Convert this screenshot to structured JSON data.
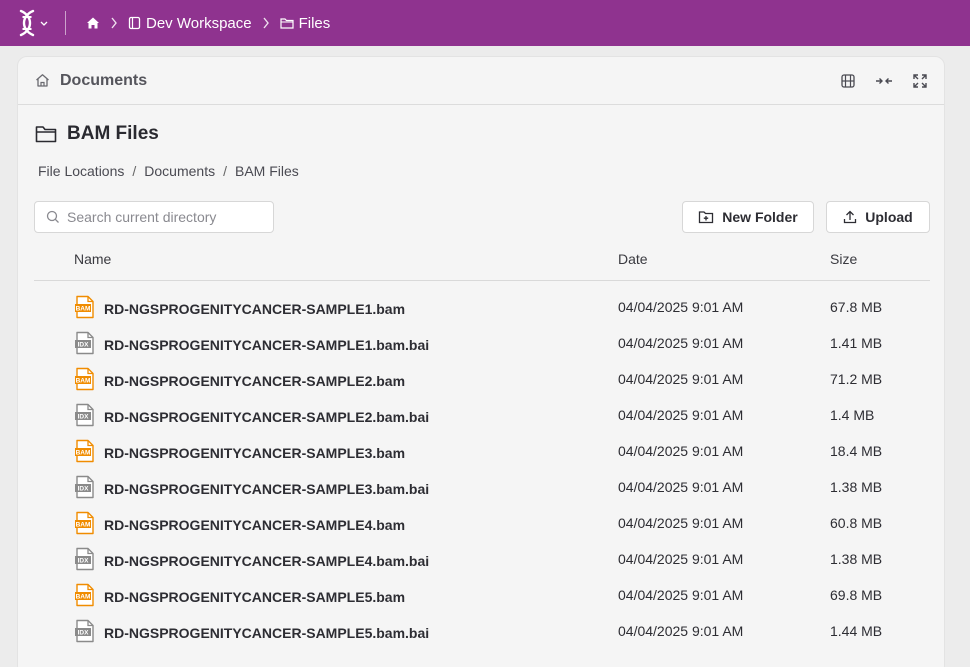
{
  "topbar": {
    "breadcrumb": [
      {
        "icon": "home-icon",
        "label": ""
      },
      {
        "icon": "workspace-icon",
        "label": "Dev Workspace"
      },
      {
        "icon": "folder-icon",
        "label": "Files"
      }
    ]
  },
  "panel": {
    "title": "Documents"
  },
  "page": {
    "title": "BAM Files",
    "path": [
      "File Locations",
      "Documents",
      "BAM Files"
    ]
  },
  "search": {
    "placeholder": "Search current directory",
    "value": ""
  },
  "actions": {
    "new_folder_label": "New Folder",
    "upload_label": "Upload"
  },
  "table": {
    "columns": {
      "name": "Name",
      "date": "Date",
      "size": "Size"
    },
    "rows": [
      {
        "name": "RD-NGSPROGENITYCANCER-SAMPLE1.bam",
        "date": "04/04/2025 9:01 AM",
        "size": "67.8 MB",
        "type": "BAM"
      },
      {
        "name": "RD-NGSPROGENITYCANCER-SAMPLE1.bam.bai",
        "date": "04/04/2025 9:01 AM",
        "size": "1.41 MB",
        "type": "IDX"
      },
      {
        "name": "RD-NGSPROGENITYCANCER-SAMPLE2.bam",
        "date": "04/04/2025 9:01 AM",
        "size": "71.2 MB",
        "type": "BAM"
      },
      {
        "name": "RD-NGSPROGENITYCANCER-SAMPLE2.bam.bai",
        "date": "04/04/2025 9:01 AM",
        "size": "1.4 MB",
        "type": "IDX"
      },
      {
        "name": "RD-NGSPROGENITYCANCER-SAMPLE3.bam",
        "date": "04/04/2025 9:01 AM",
        "size": "18.4 MB",
        "type": "BAM"
      },
      {
        "name": "RD-NGSPROGENITYCANCER-SAMPLE3.bam.bai",
        "date": "04/04/2025 9:01 AM",
        "size": "1.38 MB",
        "type": "IDX"
      },
      {
        "name": "RD-NGSPROGENITYCANCER-SAMPLE4.bam",
        "date": "04/04/2025 9:01 AM",
        "size": "60.8 MB",
        "type": "BAM"
      },
      {
        "name": "RD-NGSPROGENITYCANCER-SAMPLE4.bam.bai",
        "date": "04/04/2025 9:01 AM",
        "size": "1.38 MB",
        "type": "IDX"
      },
      {
        "name": "RD-NGSPROGENITYCANCER-SAMPLE5.bam",
        "date": "04/04/2025 9:01 AM",
        "size": "69.8 MB",
        "type": "BAM"
      },
      {
        "name": "RD-NGSPROGENITYCANCER-SAMPLE5.bam.bai",
        "date": "04/04/2025 9:01 AM",
        "size": "1.44 MB",
        "type": "IDX"
      }
    ]
  },
  "colors": {
    "topbar": "#8f338f",
    "bam_icon": "#f08c00",
    "idx_icon": "#8a8a8a"
  }
}
